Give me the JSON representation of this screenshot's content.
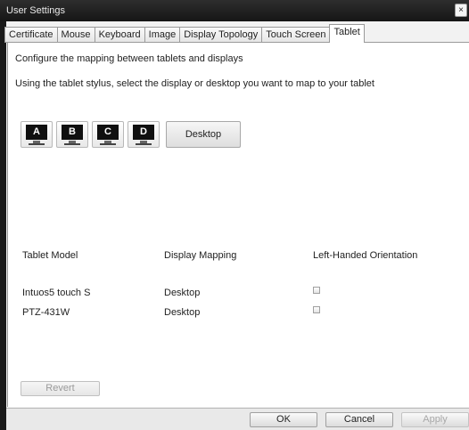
{
  "window": {
    "title": "User Settings",
    "close_glyph": "×"
  },
  "tabs": [
    {
      "label": "Certificate",
      "active": false
    },
    {
      "label": "Mouse",
      "active": false
    },
    {
      "label": "Keyboard",
      "active": false
    },
    {
      "label": "Image",
      "active": false
    },
    {
      "label": "Display Topology",
      "active": false
    },
    {
      "label": "Touch Screen",
      "active": false
    },
    {
      "label": "Tablet",
      "active": true
    }
  ],
  "panel": {
    "intro": "Configure the mapping between tablets and displays",
    "instruction": "Using the tablet stylus, select the display or desktop you want to map to your tablet",
    "displays": [
      "A",
      "B",
      "C",
      "D"
    ],
    "desktop_label": "Desktop",
    "table": {
      "headers": [
        "Tablet Model",
        "Display Mapping",
        "Left-Handed Orientation"
      ],
      "rows": [
        {
          "model": "Intuos5 touch S",
          "mapping": "Desktop",
          "left_handed": false
        },
        {
          "model": "PTZ-431W",
          "mapping": "Desktop",
          "left_handed": false
        }
      ]
    },
    "revert_label": "Revert"
  },
  "footer": {
    "ok_label": "OK",
    "cancel_label": "Cancel",
    "apply_label": "Apply"
  }
}
